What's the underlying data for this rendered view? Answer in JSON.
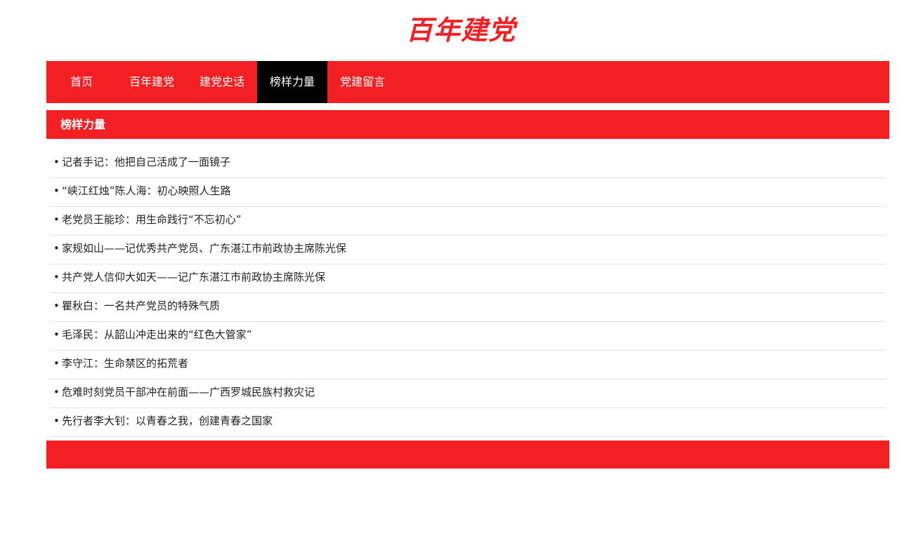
{
  "logo": {
    "text": "百年建党"
  },
  "nav": {
    "items": [
      {
        "label": "首页"
      },
      {
        "label": "百年建党"
      },
      {
        "label": "建党史话"
      },
      {
        "label": "榜样力量"
      },
      {
        "label": "党建留言"
      }
    ],
    "active": "榜样力量"
  },
  "section": {
    "title": "榜样力量"
  },
  "articles": [
    {
      "bullet": "•",
      "title": "记者手记：他把自己活成了一面镜子"
    },
    {
      "bullet": "•",
      "title": "“峡江红烛”陈人海：初心映照人生路"
    },
    {
      "bullet": "•",
      "title": "老党员王能珍：用生命践行“不忘初心”"
    },
    {
      "bullet": "•",
      "title": "家规如山——记优秀共产党员、广东湛江市前政协主席陈光保"
    },
    {
      "bullet": "•",
      "title": "共产党人信仰大如天——记广东湛江市前政协主席陈光保"
    },
    {
      "bullet": "•",
      "title": "瞿秋白：一名共产党员的特殊气质"
    },
    {
      "bullet": "•",
      "title": "毛泽民：从韶山冲走出来的“红色大管家”"
    },
    {
      "bullet": "•",
      "title": "李守江：生命禁区的拓荒者"
    },
    {
      "bullet": "•",
      "title": "危难时刻党员干部冲在前面——广西罗城民族村救灾记"
    },
    {
      "bullet": "•",
      "title": "先行者李大钊：以青春之我，创建青春之国家"
    }
  ],
  "colors": {
    "brand_red": "#f22023",
    "active_nav": "#000000"
  }
}
